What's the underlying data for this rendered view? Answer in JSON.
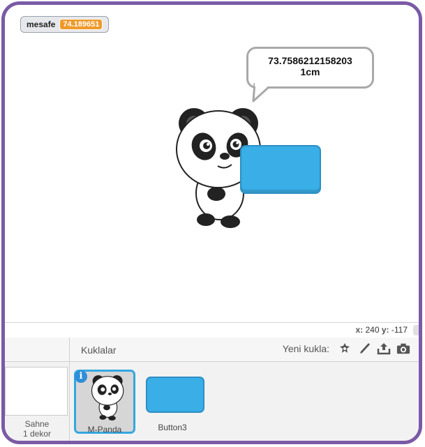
{
  "stage": {
    "variable_monitor": {
      "name": "mesafe",
      "value": "74.189651"
    },
    "speech_bubble": {
      "line1": "73.7586212158203",
      "line2": "1cm"
    },
    "sprites_on_stage": [
      "panda-sprite",
      "button3-sprite"
    ],
    "mouse_coords": {
      "x_label": "x:",
      "x_value": "240",
      "y_label": "y:",
      "y_value": "-117"
    }
  },
  "sprite_pane": {
    "title": "Kuklalar",
    "new_sprite_label": "Yeni kukla:",
    "tools": [
      "sprite-library-icon",
      "paint-brush-icon",
      "upload-icon",
      "camera-icon"
    ],
    "sprites": [
      {
        "name": "M-Panda",
        "selected": true
      },
      {
        "name": "Button3",
        "selected": false
      }
    ]
  },
  "stage_pane": {
    "label": "Sahne",
    "backdrops": "1 dekor"
  },
  "colors": {
    "frame": "#7b5aa6",
    "monitor_value_bg": "#ef9a2b",
    "button_blue": "#3aaee6",
    "selection": "#34a7e0",
    "info_badge": "#2f8ed8"
  }
}
